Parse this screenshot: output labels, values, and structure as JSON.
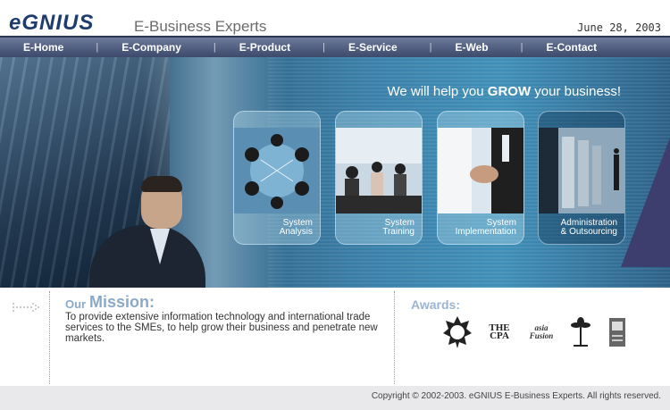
{
  "header": {
    "logo": "eGNIUS",
    "tagline": "E-Business Experts",
    "date": "June 28, 2003"
  },
  "nav": {
    "items": [
      "E-Home",
      "E-Company",
      "E-Product",
      "E-Service",
      "E-Web",
      "E-Contact"
    ],
    "separator": "|"
  },
  "hero": {
    "slogan_pre": "We will help you ",
    "slogan_bold": "GROW",
    "slogan_post": " your business!"
  },
  "cards": [
    {
      "line1": "System",
      "line2": "Analysis"
    },
    {
      "line1": "System",
      "line2": "Training"
    },
    {
      "line1": "System",
      "line2": "Implementation"
    },
    {
      "line1": "Administration",
      "line2": "& Outsourcing"
    }
  ],
  "mission": {
    "our": "Our",
    "title": "Mission:",
    "text": "To provide extensive information technology and international trade services to the SMEs, to help grow their business and penetrate new markets."
  },
  "awards": {
    "title": "Awards:",
    "logos": [
      {
        "name": "award-seal-logo",
        "text": "★"
      },
      {
        "name": "cpa-software-news-logo",
        "text": "THE CPA"
      },
      {
        "name": "asia-fusion-logo",
        "text": "asia Fusion"
      },
      {
        "name": "palm-tree-logo",
        "text": "🌴"
      },
      {
        "name": "award-plaque-logo",
        "text": "▣"
      }
    ]
  },
  "footer": {
    "copyright": "Copyright © 2002-2003.  eGNIUS E-Business Experts.  All rights reserved."
  },
  "colors": {
    "nav_bg": "#4f5c7e",
    "accent_blue": "#8aa9c7",
    "hero_blue": "#3a7fa8"
  }
}
